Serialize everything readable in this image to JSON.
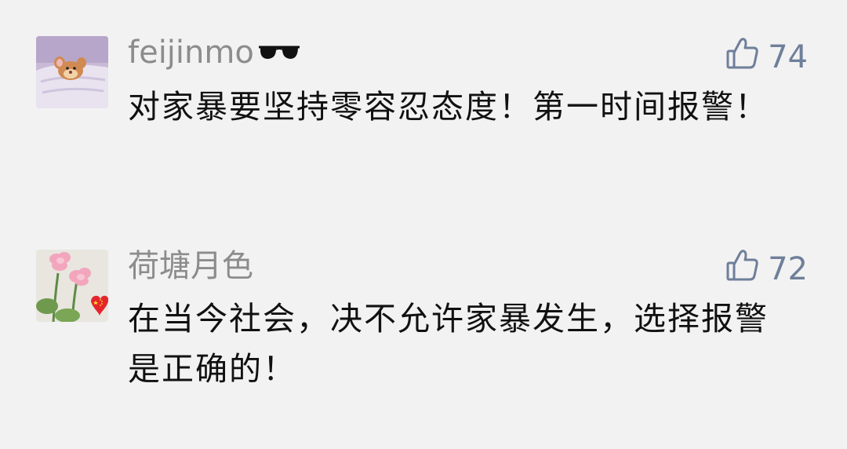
{
  "comments": [
    {
      "username": "feijinmo",
      "username_emoji": "sunglasses-icon",
      "likes": "74",
      "text": "对家暴要坚持零容忍态度！第一时间报警！",
      "avatar": "cartoon-mouse-in-bed"
    },
    {
      "username": "荷塘月色",
      "username_emoji": "",
      "likes": "72",
      "text": "在当今社会，决不允许家暴发生，选择报警是正确的！",
      "avatar": "lotus-flowers-with-china-flag-heart"
    }
  ],
  "colors": {
    "background": "#f2f2f2",
    "username": "#8c8c8c",
    "like": "#6f7f9a",
    "text": "#111111"
  }
}
